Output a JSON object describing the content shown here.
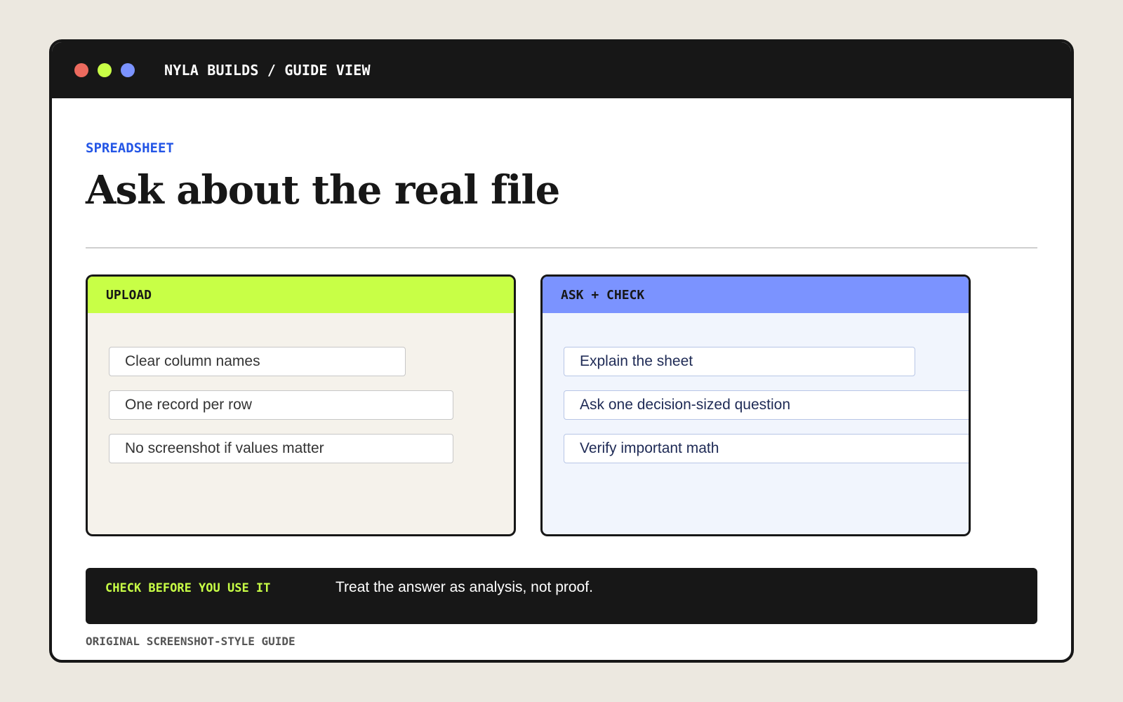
{
  "window": {
    "title": "NYLA BUILDS / GUIDE VIEW",
    "controls": [
      {
        "name": "close",
        "color": "#ec6a5e"
      },
      {
        "name": "minimize",
        "color": "#c8ff46"
      },
      {
        "name": "maximize",
        "color": "#7b93ff"
      }
    ]
  },
  "page": {
    "eyebrow": "SPREADSHEET",
    "title": "Ask about the real file"
  },
  "cards": {
    "upload": {
      "header": "UPLOAD",
      "accent": "#c8ff46",
      "background": "#f5f2eb",
      "items": [
        "Clear column names",
        "One record per row",
        "No screenshot if values matter"
      ]
    },
    "ask_check": {
      "header": "ASK + CHECK",
      "accent": "#7b93ff",
      "background": "#f1f5fd",
      "items": [
        "Explain the sheet",
        "Ask one decision-sized question",
        "Verify important math"
      ]
    }
  },
  "banner": {
    "label": "CHECK BEFORE YOU USE IT",
    "text": "Treat the answer as analysis, not proof."
  },
  "footer": {
    "note": "ORIGINAL SCREENSHOT-STYLE GUIDE"
  }
}
